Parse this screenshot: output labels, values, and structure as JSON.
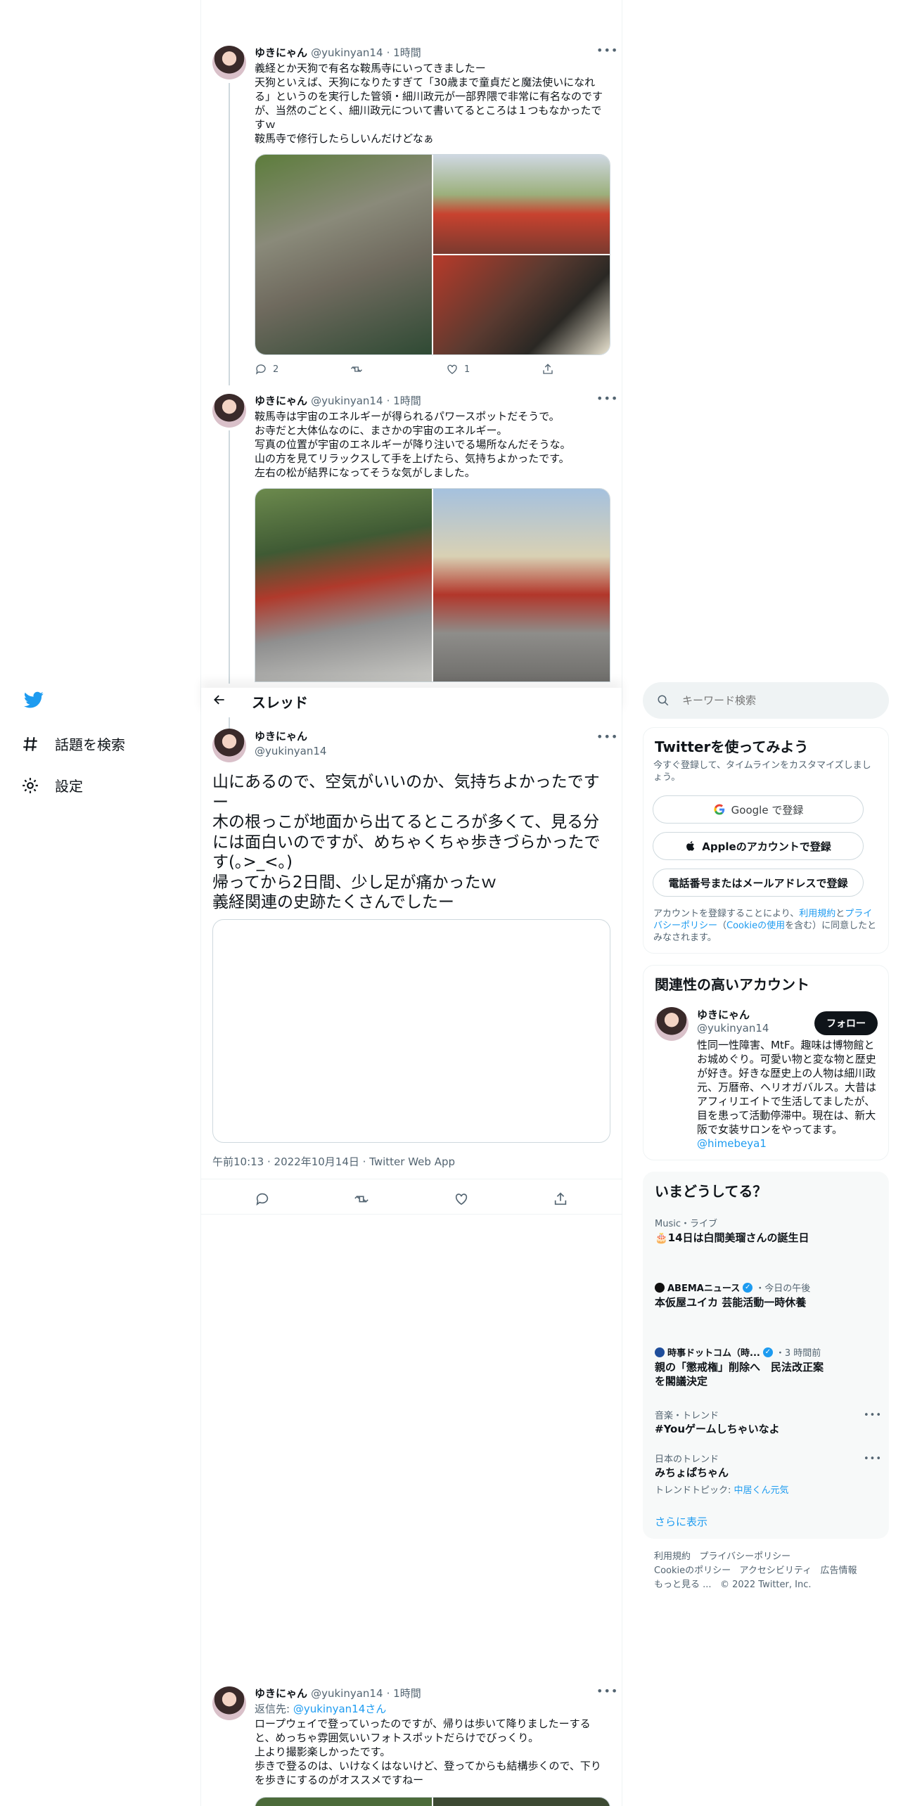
{
  "nav": {
    "explore_label": "話題を検索",
    "settings_label": "設定"
  },
  "header": {
    "title": "スレッド"
  },
  "search": {
    "placeholder": "キーワード検索"
  },
  "tweets": [
    {
      "name": "ゆきにゃん",
      "handle": "@yukinyan14",
      "time": "1時間",
      "text": "義経とか天狗で有名な鞍馬寺にいってきましたー\n天狗といえば、天狗になりたすぎて「30歳まで童貞だと魔法使いになれる」というのを実行した管領・細川政元が一部界隈で非常に有名なのですが、当然のごとく、細川政元について書いてるところは１つもなかったですｗ\n鞍馬寺で修行したらしいんだけどなぁ",
      "replies": "2",
      "retweets": "",
      "likes": "1"
    },
    {
      "name": "ゆきにゃん",
      "handle": "@yukinyan14",
      "time": "1時間",
      "text": "鞍馬寺は宇宙のエネルギーが得られるパワースポットだそうで。\nお寺だと大体仏なのに、まさかの宇宙のエネルギー。\n写真の位置が宇宙のエネルギーが降り注いでる場所なんだそうな。\n山の方を見てリラックスして手を上げたら、気持ちよかったです。\n左右の松が結界になってそうな気がしました。"
    }
  ],
  "focused": {
    "name": "ゆきにゃん",
    "handle": "@yukinyan14",
    "text": "山にあるので、空気がいいのか、気持ちよかったですー\n木の根っこが地面から出てるところが多くて、見る分には面白いのですが、めちゃくちゃ歩きづらかったです(｡>_<｡)\n帰ってから2日間、少し足が痛かったｗ\n義経関連の史跡たくさんでしたー",
    "timestamp": "午前10:13 · 2022年10月14日 · Twitter Web App"
  },
  "reply_tweet": {
    "name": "ゆきにゃん",
    "handle": "@yukinyan14",
    "time": "1時間",
    "reply_prefix": "返信先: ",
    "reply_to": "@yukinyan14",
    "reply_suffix": "さん",
    "text": "ロープウェイで登っていったのですが、帰りは歩いて降りましたーすると、めっちゃ雰囲気いいフォトスポットだらけでびっくり。\n上より撮影楽しかったです。\n歩きで登るのは、いけなくはないけど、登ってからも結構歩くので、下りを歩きにするのがオススメですねー"
  },
  "signup": {
    "title": "Twitterを使ってみよう",
    "subtitle": "今すぐ登録して、タイムラインをカスタマイズしましょう。",
    "google": "Google で登録",
    "apple": "Appleのアカウントで登録",
    "phone": "電話番号またはメールアドレスで登録",
    "terms_a": "アカウントを登録することにより、",
    "terms_link1": "利用規約",
    "terms_b": "と",
    "terms_link2": "プライバシーポリシー",
    "terms_c": "（",
    "terms_link3": "Cookieの使用",
    "terms_d": "を含む）に同意したとみなされます。"
  },
  "related": {
    "title": "関連性の高いアカウント",
    "name": "ゆきにゃん",
    "handle": "@yukinyan14",
    "follow": "フォロー",
    "bio": "性同一性障害、MtF。趣味は博物館とお城めぐり。可愛い物と変な物と歴史が好き。好きな歴史上の人物は細川政元、万暦帝、ヘリオガバルス。大昔はアフィリエイトで生活してましたが、目を患って活動停滞中。現在は、新大阪で女装サロンをやってます。",
    "bio_link": "@himebeya1"
  },
  "trends": {
    "title": "いまどうしてる？",
    "items": [
      {
        "meta": "Music・ライブ",
        "title": "🎂14日は白間美瑠さんの誕生日"
      },
      {
        "meta_source": "ABEMAニュース",
        "meta_time": "・今日の午後",
        "title": "本仮屋ユイカ 芸能活動一時休養"
      },
      {
        "meta_source": "時事ドットコム（時...",
        "meta_time": "・3 時間前",
        "title": "親の「懲戒権」削除へ　民法改正案を閣議決定"
      },
      {
        "meta": "音楽・トレンド",
        "title": "#Youゲームしちゃいなよ"
      },
      {
        "meta": "日本のトレンド",
        "title": "みちょぱちゃん",
        "topic_prefix": "トレンドトピック: ",
        "topic": "中居くん元気"
      }
    ],
    "show_more": "さらに表示"
  },
  "footer": {
    "line1": [
      "利用規約",
      "プライバシーポリシー"
    ],
    "line2": [
      "Cookieのポリシー",
      "アクセシビリティ",
      "広告情報"
    ],
    "more": "もっと見る ...",
    "copyright": "© 2022 Twitter, Inc."
  },
  "colors": {
    "accent": "#1d9bf0",
    "text": "#0f1419",
    "muted": "#536471",
    "border": "#eff3f4"
  }
}
